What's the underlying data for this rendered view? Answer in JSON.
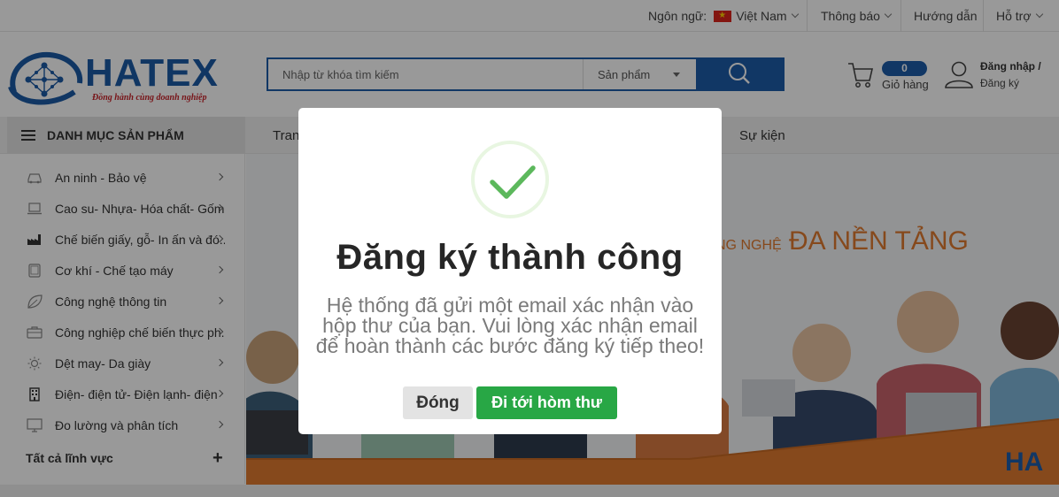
{
  "topbar": {
    "language_label": "Ngôn ngữ:",
    "language_value": "Việt Nam",
    "notifications": "Thông báo",
    "guide": "Hướng dẫn",
    "support": "Hỗ trợ"
  },
  "header": {
    "logo_text": "HATEX",
    "logo_tagline": "Đồng hành cùng doanh nghiệp",
    "search_placeholder": "Nhập từ khóa tìm kiếm",
    "search_category": "Sản phẩm",
    "cart_count": "0",
    "cart_label": "Giỏ hàng",
    "login_label": "Đăng nhập /",
    "register_label": "Đăng ký"
  },
  "nav": {
    "category_button": "DANH MỤC SẢN PHẨM",
    "items": [
      "Tran",
      "Sự kiện"
    ]
  },
  "sidebar": {
    "items": [
      {
        "label": "An ninh - Bảo vệ",
        "icon": "car-icon"
      },
      {
        "label": "Cao su- Nhựa- Hóa chất- Gốm",
        "icon": "laptop-icon"
      },
      {
        "label": "Chế biến giấy, gỗ- In ấn và đó...",
        "icon": "factory-icon"
      },
      {
        "label": "Cơ khí - Chế tạo máy",
        "icon": "tablet-icon"
      },
      {
        "label": "Công nghệ thông tin",
        "icon": "leaf-icon"
      },
      {
        "label": "Công nghiệp chế biến thực ph...",
        "icon": "briefcase-icon"
      },
      {
        "label": "Dệt may- Da giày",
        "icon": "sun-icon"
      },
      {
        "label": "Điện- điện tử- Điện lạnh- điện",
        "icon": "building-icon"
      },
      {
        "label": "Đo lường và phân tích",
        "icon": "monitor-icon"
      }
    ],
    "all_label": "Tất cả lĩnh vực",
    "all_plus": "+"
  },
  "banner": {
    "headline_prefix": "NG NGHỆ",
    "headline_main": "ĐA NỀN TẢNG",
    "corner_text": "HA"
  },
  "modal": {
    "title": "Đăng ký thành công",
    "message": "Hệ thống đã gửi một email xác nhận vào hộp thư của bạn. Vui lòng xác nhận email để hoàn thành các bước đăng ký tiếp theo!",
    "close_button": "Đóng",
    "mail_button": "Đi tới hòm thư"
  },
  "colors": {
    "brand_blue": "#1d5da8",
    "success_green": "#28a745",
    "check_green": "#5cb85c",
    "banner_orange": "#e07a2f"
  }
}
